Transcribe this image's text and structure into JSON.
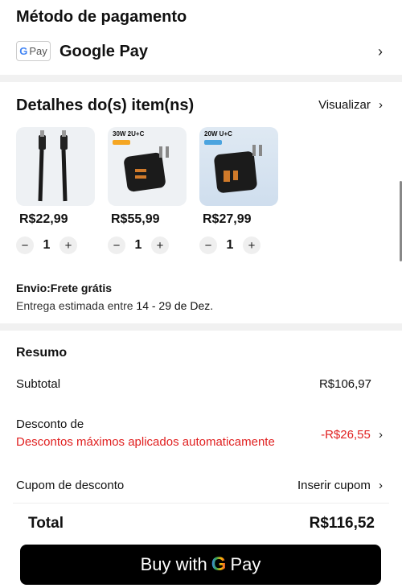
{
  "payment": {
    "title": "Método de pagamento",
    "badge_g": "G",
    "badge_text": "Pay",
    "method_name": "Google Pay",
    "chevron": "›"
  },
  "items": {
    "title": "Detalhes do(s) item(ns)",
    "view_label": "Visualizar",
    "products": [
      {
        "price": "R$22,99",
        "qty": "1",
        "image_label": ""
      },
      {
        "price": "R$55,99",
        "qty": "1",
        "image_label": "30W 2U+C"
      },
      {
        "price": "R$27,99",
        "qty": "1",
        "image_label": "20W U+C"
      }
    ],
    "minus": "−",
    "plus": "+",
    "shipping_title": "Envio:Frete grátis",
    "shipping_prefix": "Entrega estimada entre ",
    "shipping_dates": "14 - 29 de Dez."
  },
  "summary": {
    "title": "Resumo",
    "subtotal_label": "Subtotal",
    "subtotal_value": "R$106,97",
    "discount_label": "Desconto de",
    "discount_note": "Descontos máximos aplicados automaticamente",
    "discount_value": "-R$26,55",
    "coupon_label": "Cupom de desconto",
    "coupon_action": "Inserir cupom",
    "total_label": "Total",
    "total_value": "R$116,52"
  },
  "buy_button": {
    "prefix": "Buy with",
    "g": "G",
    "suffix": "Pay"
  },
  "colors": {
    "accent_red": "#e02020",
    "button_black": "#000000",
    "divider_gray": "#f1f1f1"
  }
}
